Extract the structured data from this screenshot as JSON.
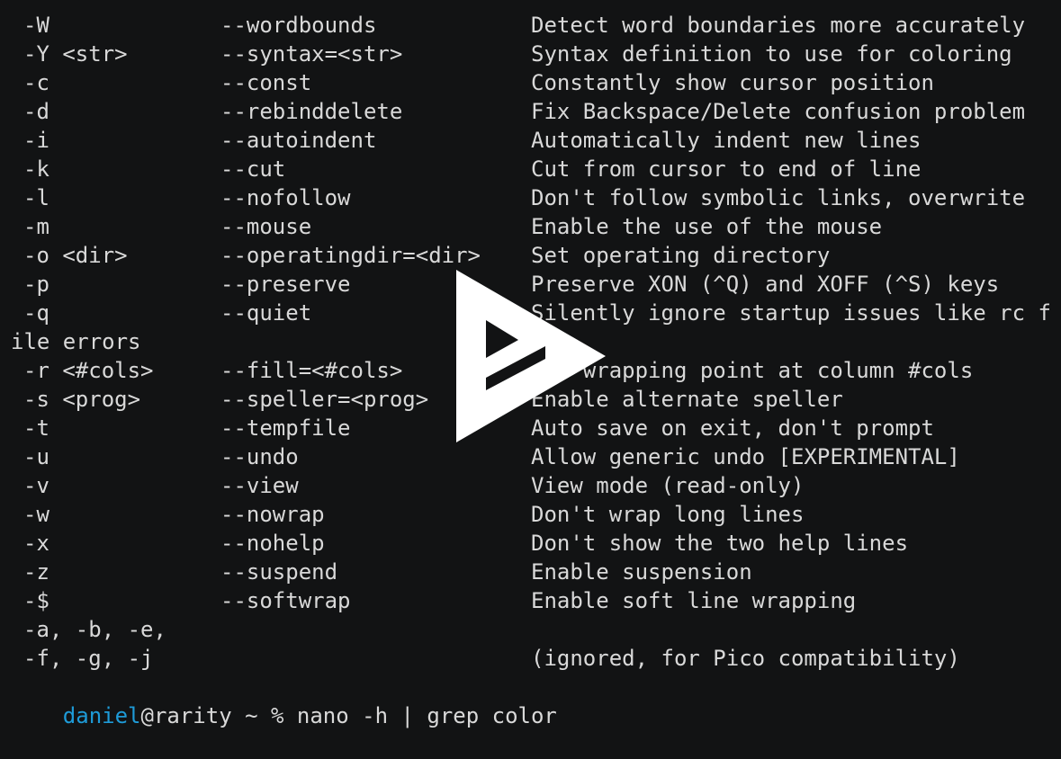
{
  "options": [
    {
      "flag": "-W",
      "long": "--wordbounds",
      "desc": "Detect word boundaries more accurately"
    },
    {
      "flag": "-Y <str>",
      "long": "--syntax=<str>",
      "desc": "Syntax definition to use for coloring"
    },
    {
      "flag": "-c",
      "long": "--const",
      "desc": "Constantly show cursor position"
    },
    {
      "flag": "-d",
      "long": "--rebinddelete",
      "desc": "Fix Backspace/Delete confusion problem"
    },
    {
      "flag": "-i",
      "long": "--autoindent",
      "desc": "Automatically indent new lines"
    },
    {
      "flag": "-k",
      "long": "--cut",
      "desc": "Cut from cursor to end of line"
    },
    {
      "flag": "-l",
      "long": "--nofollow",
      "desc": "Don't follow symbolic links, overwrite"
    },
    {
      "flag": "-m",
      "long": "--mouse",
      "desc": "Enable the use of the mouse"
    },
    {
      "flag": "-o <dir>",
      "long": "--operatingdir=<dir>",
      "desc": "Set operating directory"
    },
    {
      "flag": "-p",
      "long": "--preserve",
      "desc": "Preserve XON (^Q) and XOFF (^S) keys"
    },
    {
      "flag": "-q",
      "long": "--quiet",
      "desc": "Silently ignore startup issues like rc f"
    },
    {
      "continuation": "ile errors"
    },
    {
      "flag": "-r <#cols>",
      "long": "--fill=<#cols>",
      "desc": "Set wrapping point at column #cols"
    },
    {
      "flag": "-s <prog>",
      "long": "--speller=<prog>",
      "desc": "Enable alternate speller"
    },
    {
      "flag": "-t",
      "long": "--tempfile",
      "desc": "Auto save on exit, don't prompt"
    },
    {
      "flag": "-u",
      "long": "--undo",
      "desc": "Allow generic undo [EXPERIMENTAL]"
    },
    {
      "flag": "-v",
      "long": "--view",
      "desc": "View mode (read-only)"
    },
    {
      "flag": "-w",
      "long": "--nowrap",
      "desc": "Don't wrap long lines"
    },
    {
      "flag": "-x",
      "long": "--nohelp",
      "desc": "Don't show the two help lines"
    },
    {
      "flag": "-z",
      "long": "--suspend",
      "desc": "Enable suspension"
    },
    {
      "flag": "-$",
      "long": "--softwrap",
      "desc": "Enable soft line wrapping"
    },
    {
      "flag": "-a, -b, -e,",
      "long": "",
      "desc": ""
    },
    {
      "flag": "-f, -g, -j",
      "long": "",
      "desc": "(ignored, for Pico compatibility)"
    }
  ],
  "prompt": {
    "user": "daniel",
    "host_path": "@rarity ~ % ",
    "command": "nano -h | grep color"
  },
  "overlay": {
    "icon": "asciinema-play-icon"
  },
  "colors": {
    "background": "#121314",
    "text": "#d9d9d9",
    "user": "#1e9bd8",
    "overlay": "#ffffff"
  }
}
